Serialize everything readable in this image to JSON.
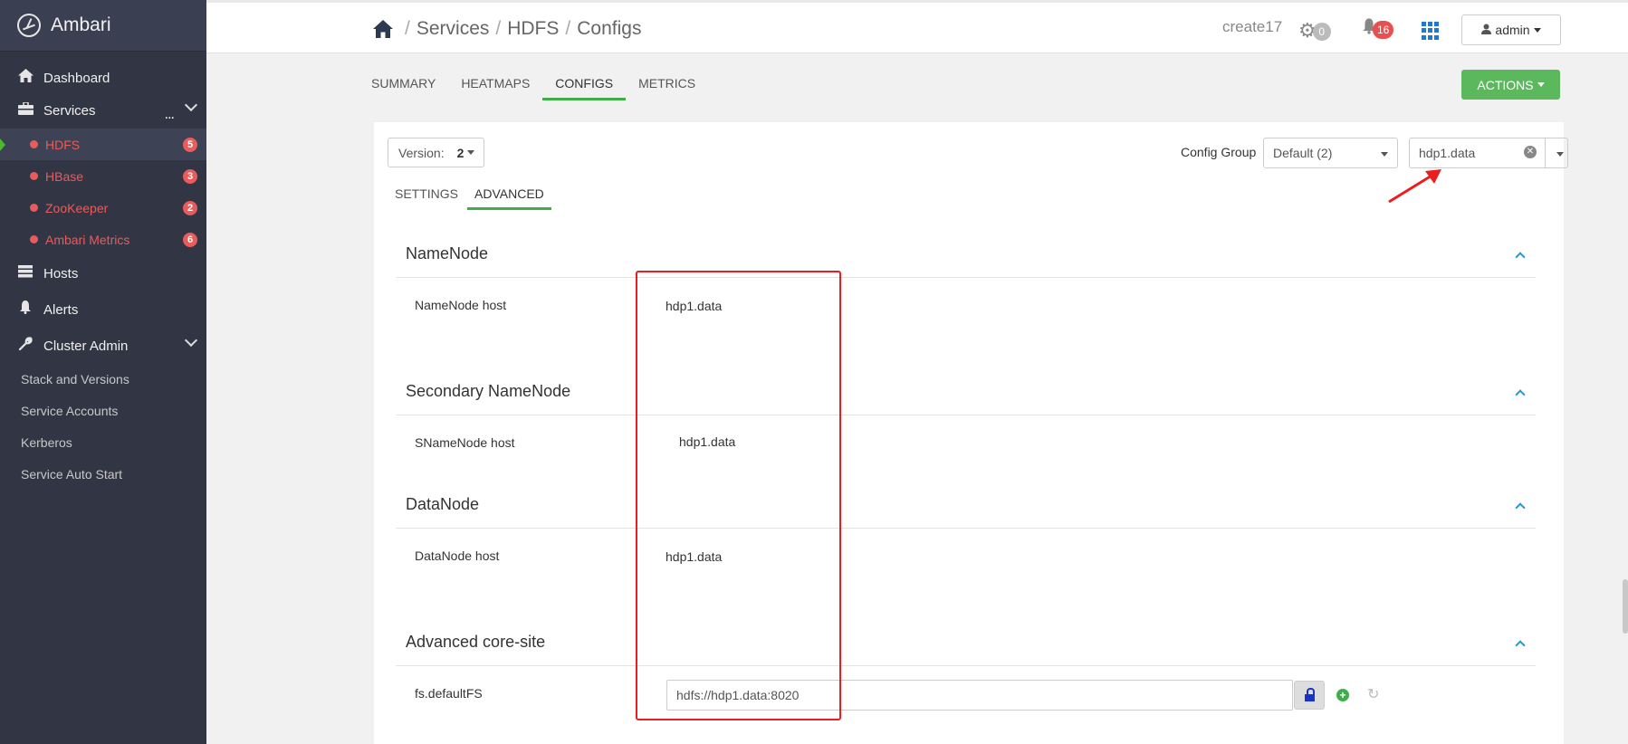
{
  "brand": {
    "name": "Ambari"
  },
  "nav": {
    "dashboard": "Dashboard",
    "services": "Services",
    "services_more": "...",
    "services_list": [
      {
        "label": "HDFS",
        "count": "5",
        "active": true
      },
      {
        "label": "HBase",
        "count": "3"
      },
      {
        "label": "ZooKeeper",
        "count": "2"
      },
      {
        "label": "Ambari Metrics",
        "count": "6"
      }
    ],
    "hosts": "Hosts",
    "alerts": "Alerts",
    "cluster_admin": "Cluster Admin",
    "admin_items": [
      "Stack and Versions",
      "Service Accounts",
      "Kerberos",
      "Service Auto Start"
    ]
  },
  "header": {
    "breadcrumb": [
      "Services",
      "HDFS",
      "Configs"
    ],
    "separator": "/",
    "cluster_name": "create17",
    "ops_count": "0",
    "alerts_count": "16",
    "user": "admin"
  },
  "service_tabs": [
    "SUMMARY",
    "HEATMAPS",
    "CONFIGS",
    "METRICS"
  ],
  "actions_label": "ACTIONS",
  "config": {
    "version_label": "Version:",
    "version_value": "2",
    "group_label": "Config Group",
    "group_value": "Default (2)",
    "filter_value": "hdp1.data",
    "tabs": [
      "SETTINGS",
      "ADVANCED"
    ]
  },
  "sections": [
    {
      "title": "NameNode",
      "prop": "NameNode host",
      "value": "hdp1.data"
    },
    {
      "title": "Secondary NameNode",
      "prop": "SNameNode host",
      "value": "hdp1.data"
    },
    {
      "title": "DataNode",
      "prop": "DataNode host",
      "value": "hdp1.data"
    },
    {
      "title": "Advanced core-site",
      "prop": "fs.defaultFS",
      "value": "hdfs://hdp1.data:8020"
    }
  ],
  "colors": {
    "sidebar_bg": "#323544",
    "service_alert": "#e85c5c",
    "active_tab": "#3fae49",
    "actions_btn": "#5cb85c",
    "annotation": "#ea1e1e"
  },
  "icons": [
    "ambari-logo-icon",
    "home-icon",
    "briefcase-icon",
    "server-icon",
    "bell-icon",
    "wrench-icon",
    "gear-icon",
    "apps-grid-icon",
    "user-icon",
    "lock-icon",
    "plus-circle-icon",
    "undo-icon",
    "chevron-up-icon"
  ]
}
